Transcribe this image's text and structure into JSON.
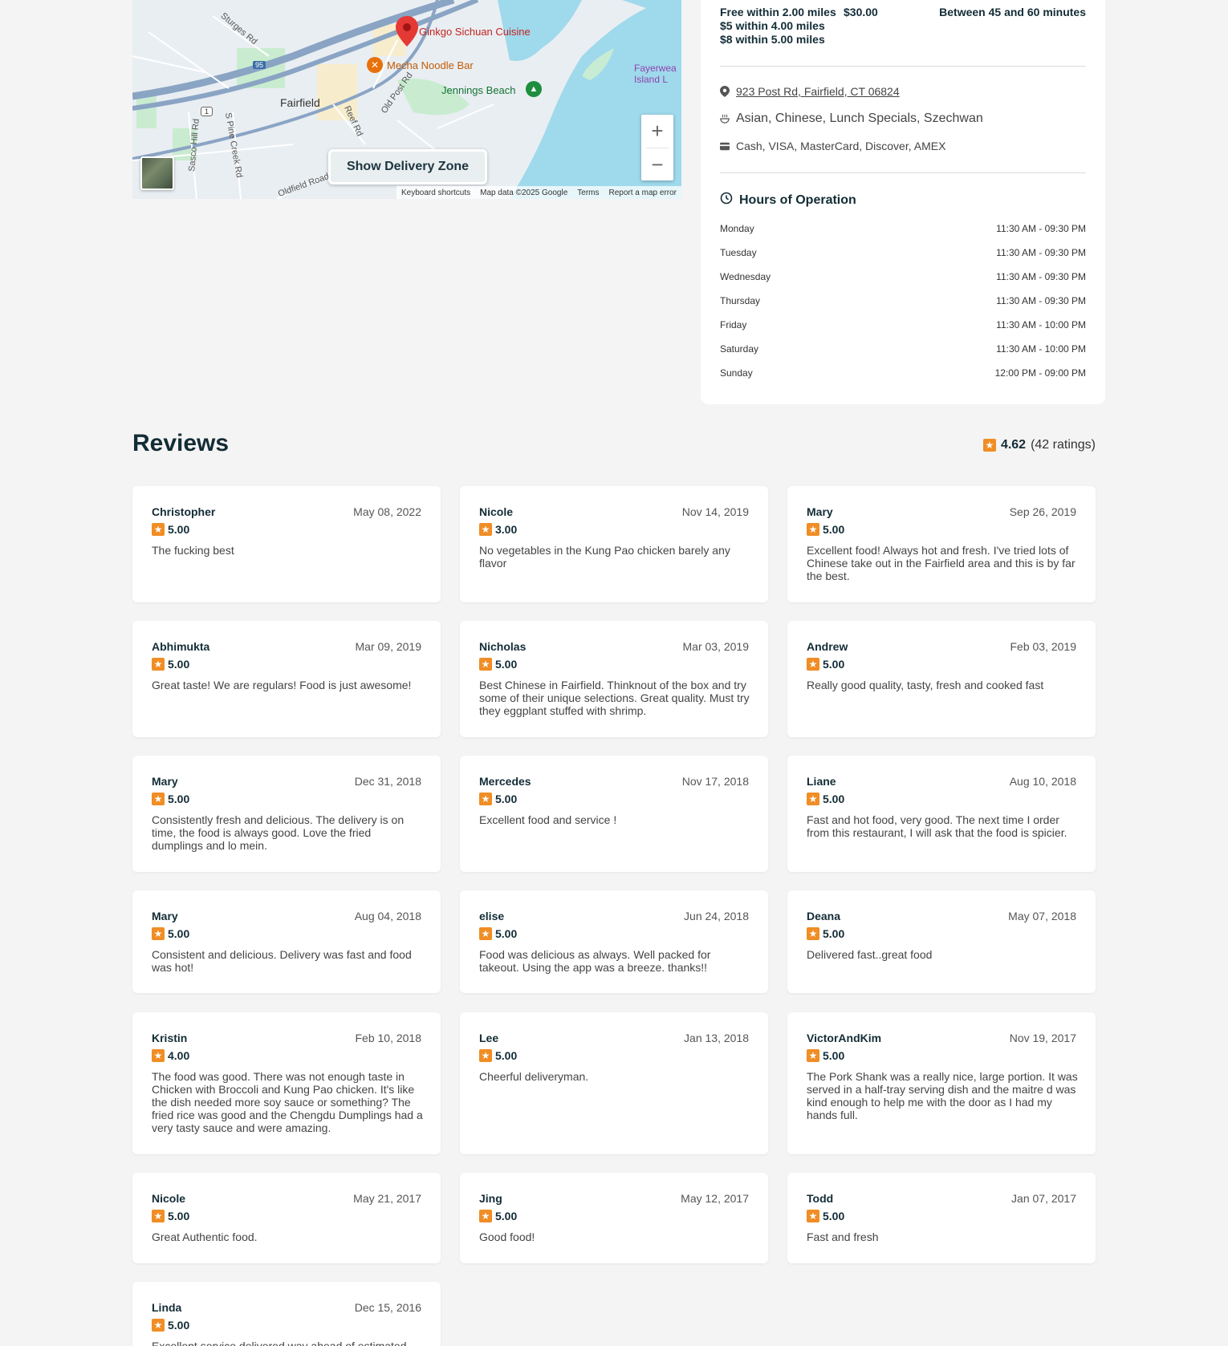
{
  "map": {
    "places": [
      "Fairfield"
    ],
    "roads": [
      "Sturges Rd",
      "Sasco Hill Rd",
      "S Pine Creek Rd",
      "Reef Rd",
      "Old Post Rd",
      "Oldfield Road"
    ],
    "highway_shields": [
      "95",
      "1"
    ],
    "pois": [
      {
        "name": "Ginkgo Sichuan Cuisine",
        "icon": "map-pin-icon",
        "color": "#d93025"
      },
      {
        "name": "Mecha Noodle Bar",
        "icon": "restaurant-icon",
        "color": "#e8710a"
      },
      {
        "name": "Jennings Beach",
        "icon": "tree-icon",
        "color": "#1e8e3e"
      },
      {
        "name": "Fayerwea Island L",
        "icon": "",
        "color": "#8e44ad"
      }
    ],
    "delivery_button": "Show Delivery Zone",
    "attribution": [
      "Keyboard shortcuts",
      "Map data ©2025 Google",
      "Terms",
      "Report a map error"
    ],
    "zoom_in": "+",
    "zoom_out": "−"
  },
  "info": {
    "fees": [
      "Free within 2.00 miles",
      "$5 within 4.00 miles",
      "$8 within 5.00 miles"
    ],
    "minimum": "$30.00",
    "delivery_time": "Between 45 and 60 minutes",
    "address": "923 Post Rd, Fairfield, CT 06824",
    "cuisines": "Asian, Chinese, Lunch Specials, Szechwan",
    "payments": "Cash, VISA, MasterCard, Discover, AMEX",
    "hours_title": "Hours of Operation",
    "hours": [
      {
        "day": "Monday",
        "time": "11:30 AM - 09:30 PM"
      },
      {
        "day": "Tuesday",
        "time": "11:30 AM - 09:30 PM"
      },
      {
        "day": "Wednesday",
        "time": "11:30 AM - 09:30 PM"
      },
      {
        "day": "Thursday",
        "time": "11:30 AM - 09:30 PM"
      },
      {
        "day": "Friday",
        "time": "11:30 AM - 10:00 PM"
      },
      {
        "day": "Saturday",
        "time": "11:30 AM - 10:00 PM"
      },
      {
        "day": "Sunday",
        "time": "12:00 PM - 09:00 PM"
      }
    ]
  },
  "reviews": {
    "title": "Reviews",
    "average": "4.62",
    "count_text": "(42 ratings)",
    "items": [
      {
        "author": "Christopher",
        "date": "May 08, 2022",
        "rating": "5.00",
        "text": "The fucking best"
      },
      {
        "author": "Nicole",
        "date": "Nov 14, 2019",
        "rating": "3.00",
        "text": "No vegetables in the Kung Pao chicken barely any flavor"
      },
      {
        "author": "Mary",
        "date": "Sep 26, 2019",
        "rating": "5.00",
        "text": "Excellent food! Always hot and fresh. I've tried lots of Chinese take out in the Fairfield area and this is by far the best."
      },
      {
        "author": "Abhimukta",
        "date": "Mar 09, 2019",
        "rating": "5.00",
        "text": "Great taste! We are regulars! Food is just awesome!"
      },
      {
        "author": "Nicholas",
        "date": "Mar 03, 2019",
        "rating": "5.00",
        "text": "Best Chinese in Fairfield. Thinknout of the box and try some of their unique selections. Great quality. Must try they eggplant stuffed with shrimp."
      },
      {
        "author": "Andrew",
        "date": "Feb 03, 2019",
        "rating": "5.00",
        "text": "Really good quality, tasty, fresh and cooked fast"
      },
      {
        "author": "Mary",
        "date": "Dec 31, 2018",
        "rating": "5.00",
        "text": "Consistently fresh and delicious. The delivery is on time, the food is always good. Love the fried dumplings and lo mein."
      },
      {
        "author": "Mercedes",
        "date": "Nov 17, 2018",
        "rating": "5.00",
        "text": "Excellent food and service !"
      },
      {
        "author": "Liane",
        "date": "Aug 10, 2018",
        "rating": "5.00",
        "text": "Fast and hot food, very good. The next time I order from this restaurant, I will ask that the food is spicier."
      },
      {
        "author": "Mary",
        "date": "Aug 04, 2018",
        "rating": "5.00",
        "text": "Consistent and delicious. Delivery was fast and food was hot!"
      },
      {
        "author": "elise",
        "date": "Jun 24, 2018",
        "rating": "5.00",
        "text": "Food was delicious as always. Well packed for takeout. Using the app was a breeze. thanks!!"
      },
      {
        "author": "Deana",
        "date": "May 07, 2018",
        "rating": "5.00",
        "text": "Delivered fast..great food"
      },
      {
        "author": "Kristin",
        "date": "Feb 10, 2018",
        "rating": "4.00",
        "text": "The food was good. There was not enough taste in Chicken with Broccoli and Kung Pao chicken. It's like the dish needed more soy sauce or something? The fried rice was good and the Chengdu Dumplings had a very tasty sauce and were amazing."
      },
      {
        "author": "Lee",
        "date": "Jan 13, 2018",
        "rating": "5.00",
        "text": "Cheerful deliveryman."
      },
      {
        "author": "VictorAndKim",
        "date": "Nov 19, 2017",
        "rating": "5.00",
        "text": "The Pork Shank was a really nice, large portion. It was served in a half-tray serving dish and the maitre d was kind enough to help me with the door as I had my hands full."
      },
      {
        "author": "Nicole",
        "date": "May 21, 2017",
        "rating": "5.00",
        "text": "Great Authentic food."
      },
      {
        "author": "Jing",
        "date": "May 12, 2017",
        "rating": "5.00",
        "text": "Good food!"
      },
      {
        "author": "Todd",
        "date": "Jan 07, 2017",
        "rating": "5.00",
        "text": "Fast and fresh"
      },
      {
        "author": "Linda",
        "date": "Dec 15, 2016",
        "rating": "5.00",
        "text": "Excellent service delivered way ahead of estimated"
      }
    ]
  }
}
